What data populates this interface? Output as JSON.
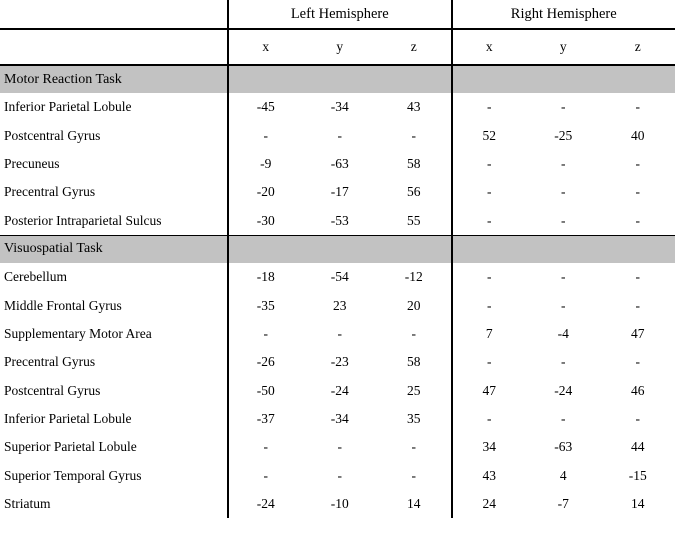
{
  "table": {
    "group_headers": {
      "region_blank": "",
      "left": "Left  Hemisphere",
      "right": "Right  Hemisphere"
    },
    "axis_headers": {
      "region_blank": "",
      "left": [
        "x",
        "y",
        "z"
      ],
      "right": [
        "x",
        "y",
        "z"
      ]
    },
    "colors": {
      "section_band": "#c2c2c2",
      "rule": "#000000",
      "page_background": "#ffffff",
      "text": "#000000"
    },
    "sections": [
      {
        "title": "Motor Reaction Task",
        "rows": [
          {
            "region": "Inferior Parietal Lobule",
            "left": [
              "-45",
              "-34",
              "43"
            ],
            "right": [
              "-",
              "-",
              "-"
            ]
          },
          {
            "region": "Postcentral Gyrus",
            "left": [
              "-",
              "-",
              "-"
            ],
            "right": [
              "52",
              "-25",
              "40"
            ]
          },
          {
            "region": "Precuneus",
            "left": [
              "-9",
              "-63",
              "58"
            ],
            "right": [
              "-",
              "-",
              "-"
            ]
          },
          {
            "region": "Precentral Gyrus",
            "left": [
              "-20",
              "-17",
              "56"
            ],
            "right": [
              "-",
              "-",
              "-"
            ]
          },
          {
            "region": "Posterior Intraparietal Sulcus",
            "left": [
              "-30",
              "-53",
              "55"
            ],
            "right": [
              "-",
              "-",
              "-"
            ]
          }
        ]
      },
      {
        "title": "Visuospatial Task",
        "rows": [
          {
            "region": "Cerebellum",
            "left": [
              "-18",
              "-54",
              "-12"
            ],
            "right": [
              "-",
              "-",
              "-"
            ]
          },
          {
            "region": "Middle Frontal Gyrus",
            "left": [
              "-35",
              "23",
              "20"
            ],
            "right": [
              "-",
              "-",
              "-"
            ]
          },
          {
            "region": "Supplementary Motor Area",
            "left": [
              "-",
              "-",
              "-"
            ],
            "right": [
              "7",
              "-4",
              "47"
            ]
          },
          {
            "region": "Precentral Gyrus",
            "left": [
              "-26",
              "-23",
              "58"
            ],
            "right": [
              "-",
              "-",
              "-"
            ]
          },
          {
            "region": "Postcentral Gyrus",
            "left": [
              "-50",
              "-24",
              "25"
            ],
            "right": [
              "47",
              "-24",
              "46"
            ]
          },
          {
            "region": "Inferior Parietal Lobule",
            "left": [
              "-37",
              "-34",
              "35"
            ],
            "right": [
              "-",
              "-",
              "-"
            ]
          },
          {
            "region": "Superior Parietal Lobule",
            "left": [
              "-",
              "-",
              "-"
            ],
            "right": [
              "34",
              "-63",
              "44"
            ]
          },
          {
            "region": "Superior Temporal Gyrus",
            "left": [
              "-",
              "-",
              "-"
            ],
            "right": [
              "43",
              "4",
              "-15"
            ]
          },
          {
            "region": "Striatum",
            "left": [
              "-24",
              "-10",
              "14"
            ],
            "right": [
              "24",
              "-7",
              "14"
            ]
          }
        ]
      }
    ]
  }
}
